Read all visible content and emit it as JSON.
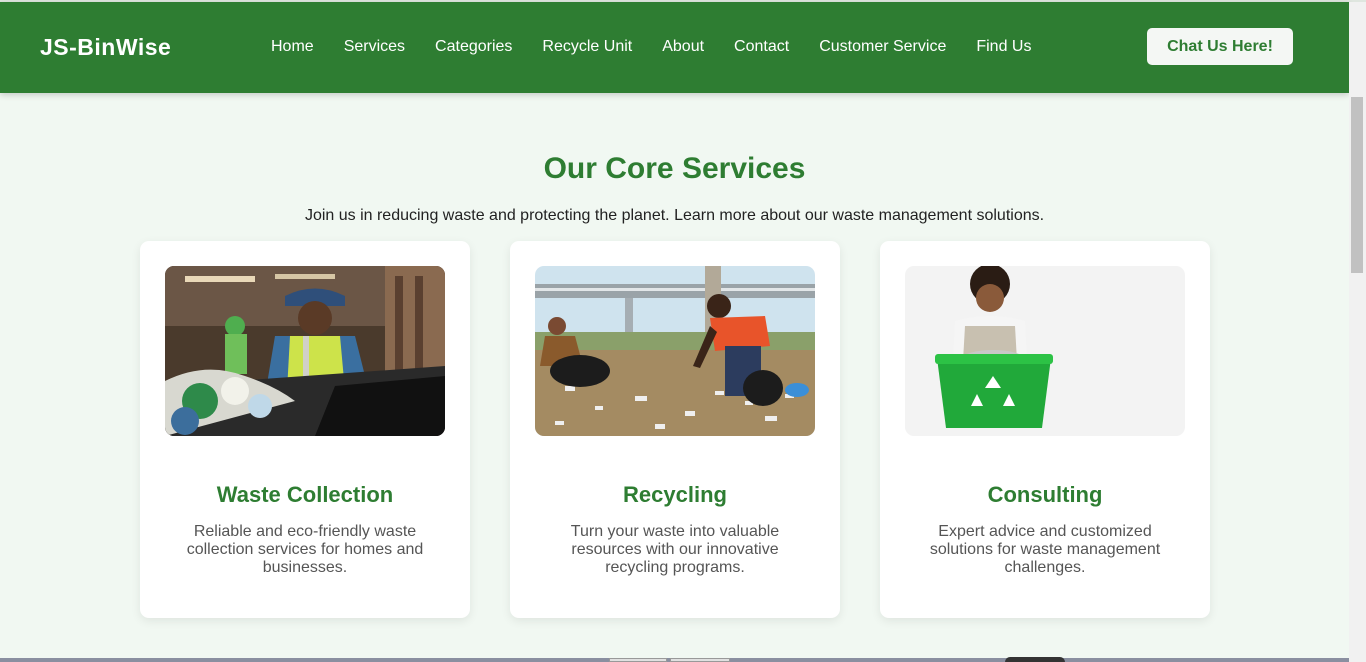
{
  "brand": {
    "name": "JS-BinWise",
    "primary_color": "#2e7d32",
    "background": "#f1f8f2"
  },
  "nav": {
    "items": [
      {
        "label": "Home"
      },
      {
        "label": "Services"
      },
      {
        "label": "Categories"
      },
      {
        "label": "Recycle Unit"
      },
      {
        "label": "About"
      },
      {
        "label": "Contact"
      },
      {
        "label": "Customer Service"
      },
      {
        "label": "Find Us"
      }
    ],
    "cta_label": "Chat Us Here!"
  },
  "services": {
    "title": "Our Core Services",
    "subtitle": "Join us in reducing waste and protecting the planet. Learn more about our waste management solutions.",
    "cards": [
      {
        "image": "worker-sorting-waste-photo",
        "title": "Waste Collection",
        "text": "Reliable and eco-friendly waste collection services for homes and businesses."
      },
      {
        "image": "volunteers-picking-litter-photo",
        "title": "Recycling",
        "text": "Turn your waste into valuable resources with our innovative recycling programs."
      },
      {
        "image": "child-with-recycling-bin-photo",
        "title": "Consulting",
        "text": "Expert advice and customized solutions for waste management challenges."
      }
    ]
  }
}
